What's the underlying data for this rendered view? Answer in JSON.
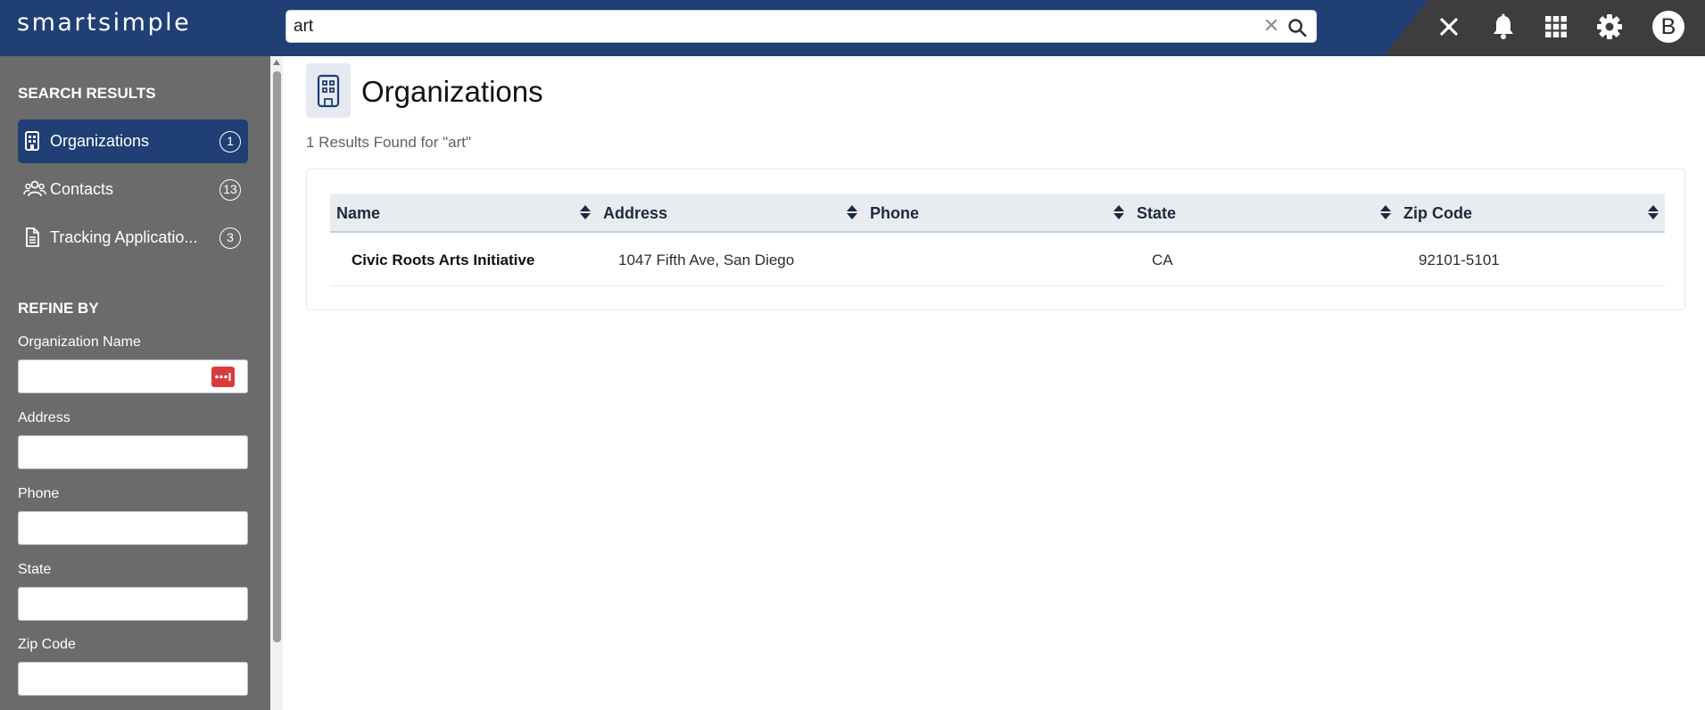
{
  "header": {
    "logo_text": "smartsimple",
    "search": {
      "value": "art",
      "placeholder": "",
      "clear_symbol": "✕"
    },
    "icons": [
      "close-icon",
      "bell-icon",
      "apps-grid-icon",
      "gear-icon"
    ],
    "avatar_initial": "B",
    "colors": {
      "primary": "#1f3f75",
      "dark": "#3d3d3d"
    }
  },
  "sidebar": {
    "search_results_heading": "SEARCH RESULTS",
    "items": [
      {
        "label": "Organizations",
        "count": "1",
        "icon": "building-icon",
        "active": true
      },
      {
        "label": "Contacts",
        "count": "13",
        "icon": "people-icon",
        "active": false
      },
      {
        "label": "Tracking Applicatio...",
        "count": "3",
        "icon": "document-icon",
        "active": false
      }
    ],
    "refine_heading": "REFINE BY",
    "fields": [
      {
        "label": "Organization Name",
        "value": "",
        "has_lookup": true
      },
      {
        "label": "Address",
        "value": ""
      },
      {
        "label": "Phone",
        "value": ""
      },
      {
        "label": "State",
        "value": ""
      },
      {
        "label": "Zip Code",
        "value": ""
      }
    ]
  },
  "main": {
    "title": "Organizations",
    "result_count": "1 Results Found for \"art\"",
    "table": {
      "columns": [
        "Name",
        "Address",
        "Phone",
        "State",
        "Zip Code"
      ],
      "rows": [
        {
          "name": "Civic Roots Arts Initiative",
          "address": "1047 Fifth Ave, San Diego",
          "phone": "",
          "state": "CA",
          "zip": "92101-5101"
        }
      ]
    }
  }
}
